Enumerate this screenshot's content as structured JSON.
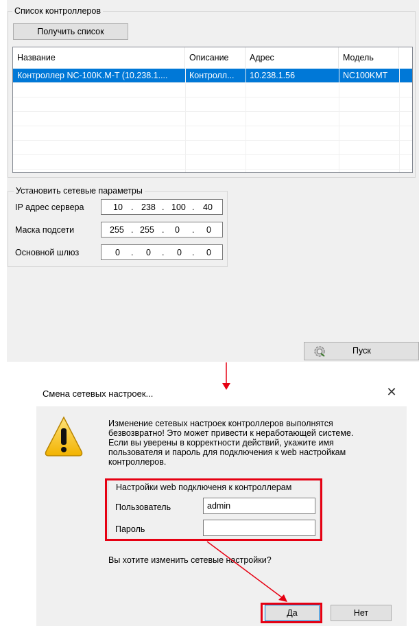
{
  "controllers_group": {
    "title": "Список контроллеров",
    "get_list_button": "Получить список",
    "columns": [
      "Название",
      "Описание",
      "Адрес",
      "Модель"
    ],
    "rows": [
      {
        "name": "Контроллер NC-100K.M-T (10.238.1....",
        "description": "Контролл...",
        "address": "10.238.1.56",
        "model": "NC100KMT",
        "selected": true
      }
    ]
  },
  "network_group": {
    "title": "Установить сетевые параметры",
    "fields": [
      {
        "label": "IP адрес сервера",
        "octets": [
          "10",
          "238",
          "100",
          "40"
        ]
      },
      {
        "label": "Маска подсети",
        "octets": [
          "255",
          "255",
          "0",
          "0"
        ]
      },
      {
        "label": "Основной шлюз",
        "octets": [
          "0",
          "0",
          "0",
          "0"
        ]
      }
    ],
    "separator": "."
  },
  "start_button": {
    "label": "Пуск",
    "icon": "gear-run-icon"
  },
  "dialog": {
    "title": "Смена сетевых настроек...",
    "close_glyph": "✕",
    "icon": "warning-icon",
    "message": [
      "Изменение сетевых настроек контроллеров выполнятся",
      "безвозвратно! Это может привести к неработающей системе.",
      "Если вы уверены в корректности действий, укажите имя",
      "пользователя и пароль для подключения к web настройкам",
      "контроллеров."
    ],
    "web_group": {
      "title": "Настройки web подключеня к контроллерам",
      "user_label": "Пользователь",
      "user_value": "admin",
      "password_label": "Пароль",
      "password_value": ""
    },
    "question": "Вы хотите изменить сетевые настройки?",
    "yes_button": "Да",
    "no_button": "Нет"
  },
  "colors": {
    "selection": "#0078d7",
    "annotation_red": "#e60012",
    "warning_yellow": "#f5c400",
    "panel_bg": "#f0f0f0"
  }
}
